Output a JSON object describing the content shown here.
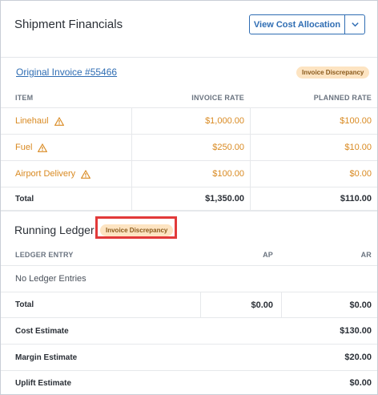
{
  "header": {
    "title": "Shipment Financials",
    "button_label": "View Cost Allocation"
  },
  "invoice": {
    "link_text": "Original Invoice #55466",
    "badge": "Invoice Discrepancy"
  },
  "invoice_table": {
    "columns": [
      "ITEM",
      "INVOICE RATE",
      "PLANNED RATE"
    ],
    "rows": [
      {
        "item": "Linehaul",
        "invoice_rate": "$1,000.00",
        "planned_rate": "$100.00"
      },
      {
        "item": "Fuel",
        "invoice_rate": "$250.00",
        "planned_rate": "$10.00"
      },
      {
        "item": "Airport Delivery",
        "invoice_rate": "$100.00",
        "planned_rate": "$0.00"
      }
    ],
    "total": {
      "label": "Total",
      "invoice_rate": "$1,350.00",
      "planned_rate": "$110.00"
    }
  },
  "ledger": {
    "title": "Running Ledger",
    "badge": "Invoice Discrepancy",
    "columns": [
      "LEDGER ENTRY",
      "AP",
      "AR"
    ],
    "empty_text": "No Ledger Entries",
    "total": {
      "label": "Total",
      "ap": "$0.00",
      "ar": "$0.00"
    },
    "summary": [
      {
        "label": "Cost Estimate",
        "value": "$130.00"
      },
      {
        "label": "Margin Estimate",
        "value": "$20.00"
      },
      {
        "label": "Uplift Estimate",
        "value": "$0.00"
      }
    ]
  },
  "colors": {
    "accent": "#2f6db3",
    "warning": "#d98a22",
    "badge_bg": "#fde4c2",
    "highlight": "#e23a3a"
  },
  "icons": {
    "dropdown": "chevron-down-icon",
    "warning": "warning-triangle-icon"
  }
}
